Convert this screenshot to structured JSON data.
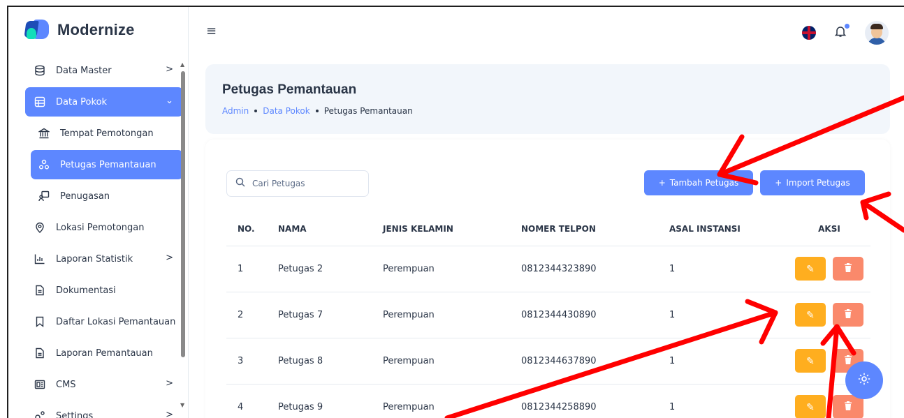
{
  "brand": {
    "name": "Modernize"
  },
  "sidebar": {
    "items": [
      {
        "label": "Data Master",
        "icon": "database-icon",
        "chevron": ">"
      },
      {
        "label": "Data Pokok",
        "icon": "table-icon",
        "chevron": "⌄",
        "active": true
      },
      {
        "label": "Tempat Pemotongan",
        "icon": "bank-icon"
      },
      {
        "label": "Petugas Pemantauan",
        "icon": "users-icon",
        "active": true
      },
      {
        "label": "Penugasan",
        "icon": "assignment-icon"
      },
      {
        "label": "Lokasi Pemotongan",
        "icon": "location-icon"
      },
      {
        "label": "Laporan Statistik",
        "icon": "chart-icon",
        "chevron": ">"
      },
      {
        "label": "Dokumentasi",
        "icon": "file-icon"
      },
      {
        "label": "Daftar Lokasi Pemantauan",
        "icon": "bookmark-icon"
      },
      {
        "label": "Laporan Pemantauan",
        "icon": "file-icon"
      },
      {
        "label": "CMS",
        "icon": "cms-icon",
        "chevron": ">"
      },
      {
        "label": "Settings",
        "icon": "settings-icon",
        "chevron": ">"
      }
    ]
  },
  "header": {
    "hamburger": "≡"
  },
  "page": {
    "title": "Petugas Pemantauan",
    "breadcrumb": [
      "Admin",
      "Data Pokok",
      "Petugas Pemantauan"
    ]
  },
  "toolbar": {
    "search_placeholder": "Cari Petugas",
    "add_label": "Tambah Petugas",
    "import_label": "Import Petugas"
  },
  "table": {
    "headers": [
      "NO.",
      "NAMA",
      "JENIS KELAMIN",
      "NOMER TELPON",
      "ASAL INSTANSI",
      "AKSI"
    ],
    "rows": [
      {
        "no": "1",
        "nama": "Petugas 2",
        "jk": "Perempuan",
        "telp": "0812344323890",
        "asal": "1"
      },
      {
        "no": "2",
        "nama": "Petugas 7",
        "jk": "Perempuan",
        "telp": "0812344430890",
        "asal": "1"
      },
      {
        "no": "3",
        "nama": "Petugas 8",
        "jk": "Perempuan",
        "telp": "0812344637890",
        "asal": "1"
      },
      {
        "no": "4",
        "nama": "Petugas 9",
        "jk": "Perempuan",
        "telp": "0812344258890",
        "asal": "1"
      }
    ]
  },
  "colors": {
    "primary": "#5d87ff",
    "edit": "#ffae1f",
    "delete": "#fa896b",
    "annotation": "#ff0000"
  }
}
